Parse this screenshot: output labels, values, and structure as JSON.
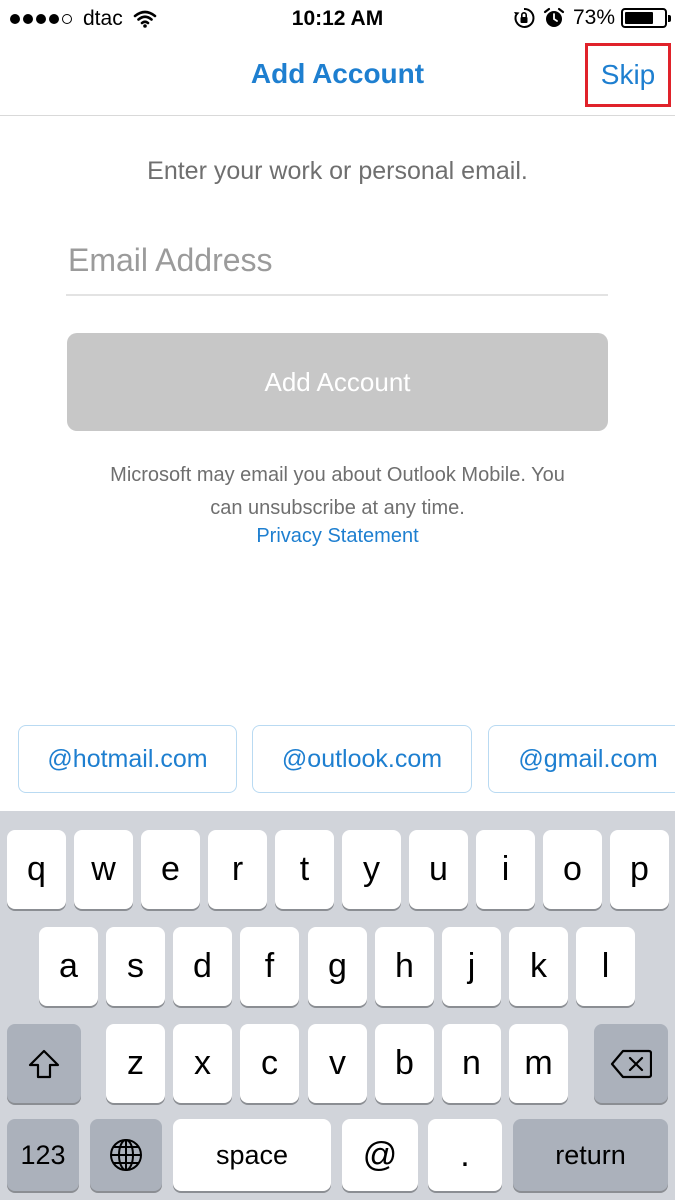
{
  "status_bar": {
    "carrier": "dtac",
    "time": "10:12 AM",
    "battery_text": "73%",
    "battery_level": 0.73,
    "signal_bars": 4,
    "icons": [
      "signal-dots-icon",
      "wifi-icon",
      "rotation-lock-icon",
      "alarm-icon",
      "battery-icon"
    ]
  },
  "nav": {
    "title": "Add Account",
    "skip_label": "Skip",
    "highlight_color": "#e0222a"
  },
  "form": {
    "prompt": "Enter your work or personal email.",
    "email_placeholder": "Email Address",
    "email_value": "",
    "add_button_label": "Add Account",
    "notice_line1": "Microsoft may email you about Outlook Mobile. You",
    "notice_line2": "can unsubscribe at any time.",
    "privacy_link": "Privacy Statement"
  },
  "suggestions": [
    "@hotmail.com",
    "@outlook.com",
    "@gmail.com"
  ],
  "keyboard": {
    "row1": [
      "q",
      "w",
      "e",
      "r",
      "t",
      "y",
      "u",
      "i",
      "o",
      "p"
    ],
    "row2": [
      "a",
      "s",
      "d",
      "f",
      "g",
      "h",
      "j",
      "k",
      "l"
    ],
    "row3": [
      "z",
      "x",
      "c",
      "v",
      "b",
      "n",
      "m"
    ],
    "numbers_label": "123",
    "space_label": "space",
    "at_label": "@",
    "dot_label": ".",
    "return_label": "return",
    "icons": [
      "shift-icon",
      "backspace-icon",
      "globe-icon"
    ]
  },
  "colors": {
    "accent": "#1e7fd0",
    "disabled_button": "#c7c7c7",
    "keyboard_bg": "#d1d4da"
  }
}
